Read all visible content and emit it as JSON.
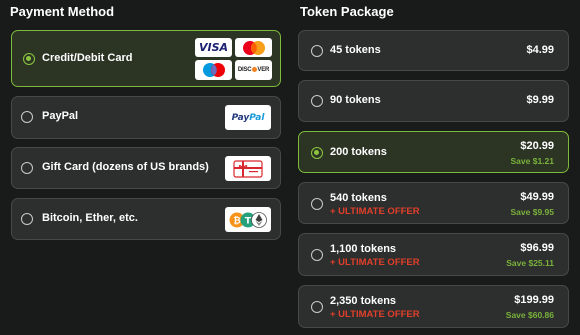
{
  "payment_method": {
    "title": "Payment Method",
    "options": [
      {
        "label": "Credit/Debit Card",
        "selected": true,
        "logos": [
          "VISA",
          "Mastercard",
          "Maestro",
          "DISCOVER"
        ]
      },
      {
        "label": "PayPal",
        "selected": false,
        "logo": "PayPal"
      },
      {
        "label": "Gift Card (dozens of US brands)",
        "selected": false,
        "logo": "gift-card-icon"
      },
      {
        "label": "Bitcoin, Ether, etc.",
        "selected": false,
        "logo": "crypto-coins-icon"
      }
    ]
  },
  "token_package": {
    "title": "Token Package",
    "options": [
      {
        "label": "45 tokens",
        "price": "$4.99",
        "selected": false
      },
      {
        "label": "90 tokens",
        "price": "$9.99",
        "selected": false
      },
      {
        "label": "200 tokens",
        "price": "$20.99",
        "save": "Save $1.21",
        "selected": true
      },
      {
        "label": "540 tokens",
        "offer": "+ ULTIMATE OFFER",
        "price": "$49.99",
        "save": "Save $9.95",
        "selected": false
      },
      {
        "label": "1,100 tokens",
        "offer": "+ ULTIMATE OFFER",
        "price": "$96.99",
        "save": "Save $25.11",
        "selected": false
      },
      {
        "label": "2,350 tokens",
        "offer": "+ ULTIMATE OFFER",
        "price": "$199.99",
        "save": "Save $60.86",
        "selected": false
      }
    ]
  },
  "logo_text": {
    "visa": "VISA",
    "paypal_a": "Pay",
    "paypal_b": "Pal",
    "discover_a": "DISC",
    "discover_b": "VER"
  },
  "colors": {
    "accent": "#8cc63f",
    "save_text": "#7ab23b",
    "offer_text": "#e0402b",
    "card_bg": "#2d2e2e",
    "selected_bg": "#2c3524",
    "page_bg": "#191a1a"
  }
}
